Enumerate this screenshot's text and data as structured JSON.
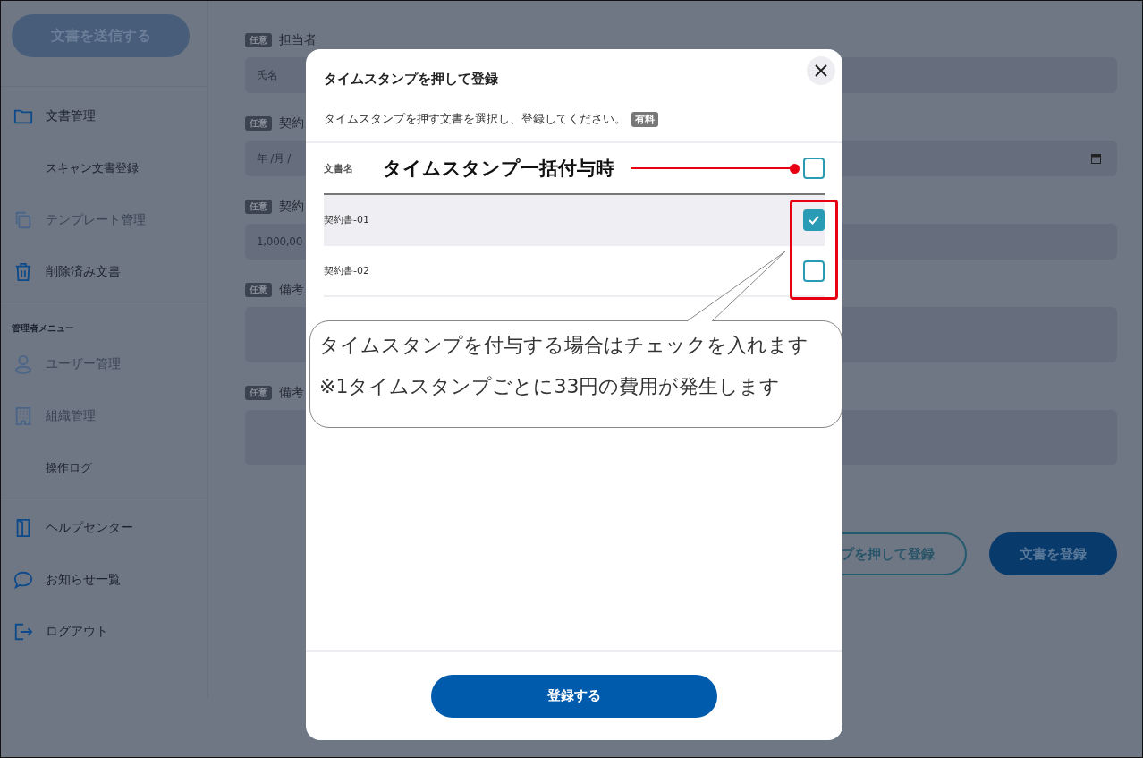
{
  "sidebar": {
    "send_button": "文書を送信する",
    "groups": [
      {
        "items": [
          {
            "label": "文書管理",
            "kind": "main",
            "disabled": false
          },
          {
            "label": "スキャン文書登録",
            "kind": "sub",
            "disabled": false
          },
          {
            "label": "テンプレート管理",
            "kind": "main",
            "disabled": true
          },
          {
            "label": "削除済み文書",
            "kind": "main",
            "disabled": false
          }
        ]
      },
      {
        "heading": "管理者メニュー",
        "items": [
          {
            "label": "ユーザー管理",
            "kind": "main",
            "disabled": true
          },
          {
            "label": "組織管理",
            "kind": "main",
            "disabled": true
          },
          {
            "label": "操作ログ",
            "kind": "sub",
            "disabled": false
          }
        ]
      },
      {
        "items": [
          {
            "label": "ヘルプセンター",
            "kind": "main",
            "disabled": false
          },
          {
            "label": "お知らせ一覧",
            "kind": "main",
            "disabled": false
          },
          {
            "label": "ログアウト",
            "kind": "main",
            "disabled": false
          }
        ]
      }
    ]
  },
  "form": {
    "fields": [
      {
        "badge": "任意",
        "label": "担当者",
        "kind": "text",
        "placeholder": "氏名"
      },
      {
        "badge": "任意",
        "label": "契約",
        "kind": "date",
        "placeholder": "年 /月 /"
      },
      {
        "badge": "任意",
        "label": "契約",
        "kind": "text",
        "value": "1,000,00"
      },
      {
        "badge": "任意",
        "label": "備考",
        "kind": "textarea"
      },
      {
        "badge": "任意",
        "label": "備考",
        "kind": "textarea"
      }
    ],
    "buttons": [
      {
        "label": "プを押して登録",
        "kind": "outline"
      },
      {
        "label": "文書を登録",
        "kind": "solid"
      }
    ]
  },
  "dialog": {
    "title": "タイムスタンプを押して登録",
    "description": "タイムスタンプを押す文書を選択し、登録してください。",
    "badge": "有料",
    "header": {
      "label": "文書名",
      "checked": false
    },
    "rows": [
      {
        "name": "契約書-01",
        "checked": true,
        "selected": true
      },
      {
        "name": "契約書-02",
        "checked": false,
        "selected": false
      }
    ],
    "submit": "登録する"
  },
  "annotation": {
    "label": "タイムスタンプ一括付与時",
    "callout": [
      "タイムスタンプを付与する場合はチェックを入れます",
      "※1タイムスタンプごとに33円の費用が発生します"
    ]
  }
}
